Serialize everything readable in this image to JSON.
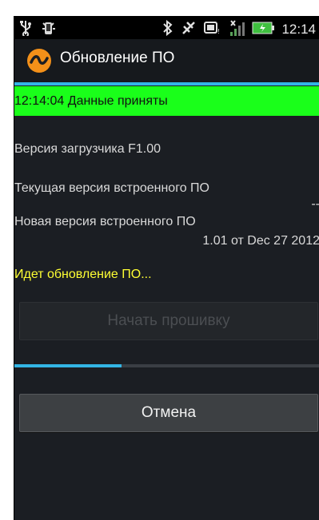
{
  "status_bar": {
    "icons_left": [
      "usb-icon",
      "debug-icon"
    ],
    "icons_right": [
      "bluetooth-icon",
      "mute-icon",
      "nfc-icon",
      "signal-icon",
      "battery-icon"
    ],
    "time": "12:14"
  },
  "action_bar": {
    "title": "Обновление ПО",
    "icon": "app-logo-icon",
    "accent_color": "#33b5e5"
  },
  "status_banner": {
    "text": "12:14:04 Данные приняты",
    "color": "#1aff1a"
  },
  "info": {
    "bootloader_label": "Версия загрузчика F1.00",
    "current_fw_label": "Текущая версия встроенного ПО",
    "current_fw_value": "--",
    "new_fw_label": "Новая версия встроенного ПО",
    "new_fw_value": "1.01 от Dec 27 2012"
  },
  "progress": {
    "text": "Идет обновление ПО...",
    "fraction": 0.35,
    "color": "#33b5e5"
  },
  "buttons": {
    "start_label": "Начать прошивку",
    "cancel_label": "Отмена"
  }
}
